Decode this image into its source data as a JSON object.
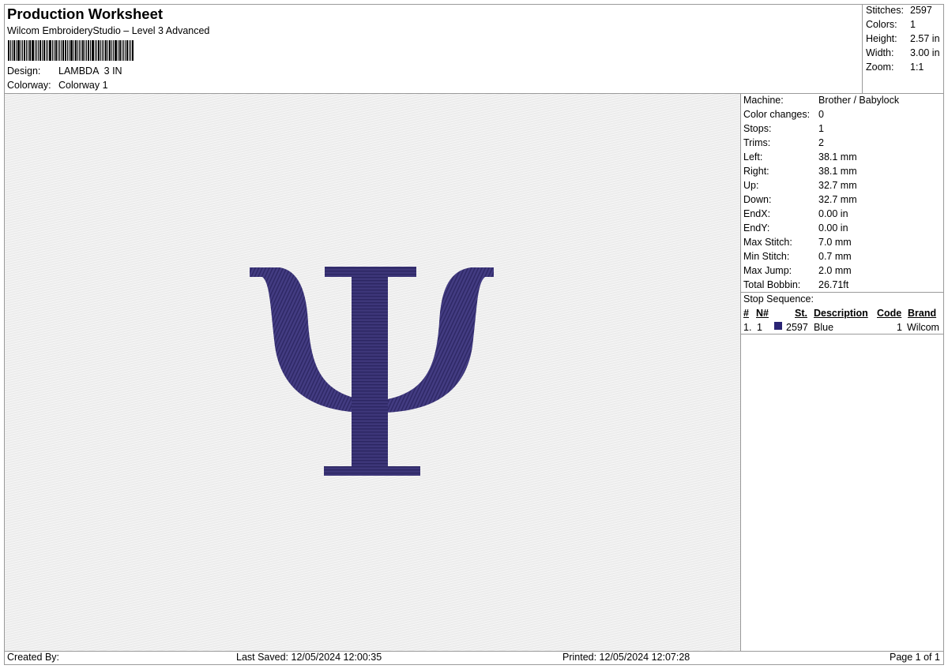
{
  "header": {
    "title": "Production Worksheet",
    "software": "Wilcom EmbroideryStudio – Level 3 Advanced",
    "design_label": "Design:",
    "design_value": "LAMBDA  3 IN",
    "colorway_label": "Colorway:",
    "colorway_value": "Colorway 1"
  },
  "summary": [
    {
      "label": "Stitches:",
      "value": "2597"
    },
    {
      "label": "Colors:",
      "value": "1"
    },
    {
      "label": "Height:",
      "value": "2.57 in"
    },
    {
      "label": "Width:",
      "value": "3.00 in"
    },
    {
      "label": "Zoom:",
      "value": "1:1"
    }
  ],
  "details": [
    {
      "label": "Machine:",
      "value": "Brother / Babylock"
    },
    {
      "label": "Color changes:",
      "value": "0"
    },
    {
      "label": "Stops:",
      "value": "1"
    },
    {
      "label": "Trims:",
      "value": "2"
    },
    {
      "label": "Left:",
      "value": "38.1 mm"
    },
    {
      "label": "Right:",
      "value": "38.1 mm"
    },
    {
      "label": "Up:",
      "value": "32.7 mm"
    },
    {
      "label": "Down:",
      "value": "32.7 mm"
    },
    {
      "label": "EndX:",
      "value": "0.00 in"
    },
    {
      "label": "EndY:",
      "value": "0.00 in"
    },
    {
      "label": "Max Stitch:",
      "value": "7.0 mm"
    },
    {
      "label": "Min Stitch:",
      "value": "0.7 mm"
    },
    {
      "label": "Max Jump:",
      "value": "2.0 mm"
    },
    {
      "label": "Total Bobbin:",
      "value": "26.71ft"
    }
  ],
  "stop_sequence": {
    "label": "Stop Sequence:",
    "columns": [
      "#",
      "N#",
      "St.",
      "Description",
      "Code",
      "Brand"
    ],
    "rows": [
      {
        "num": "1.",
        "n": "1",
        "st": "2597",
        "description": "Blue",
        "code": "1",
        "brand": "Wilcom",
        "color": "#2a2474"
      }
    ]
  },
  "design_preview": {
    "glyph": "Ψ",
    "thread_color": "#3b3478"
  },
  "footer": {
    "created_by": "Created By:",
    "last_saved": "Last Saved: 12/05/2024 12:00:35",
    "printed": "Printed: 12/05/2024 12:07:28",
    "page": "Page 1 of 1"
  }
}
